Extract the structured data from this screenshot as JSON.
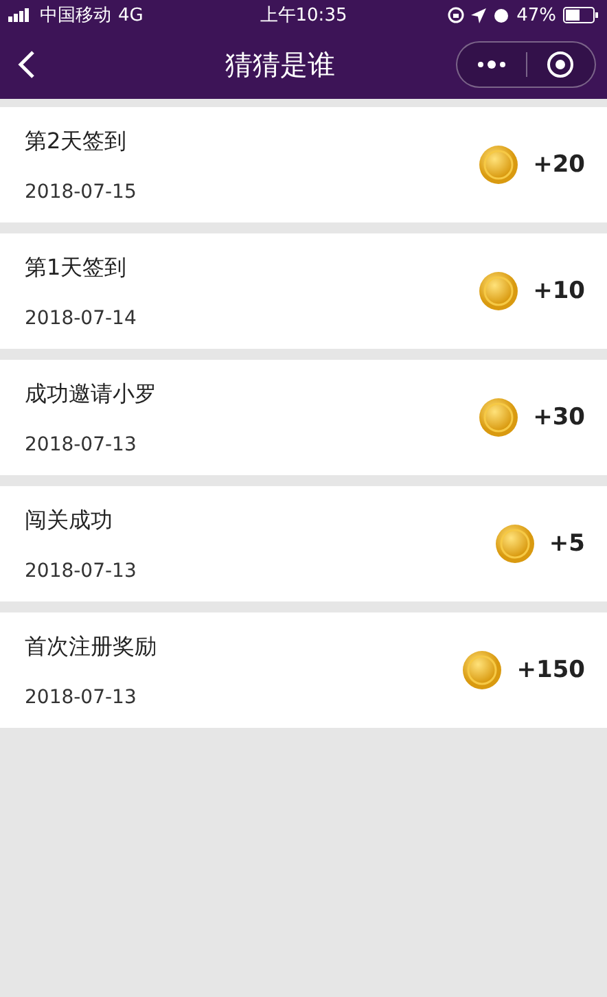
{
  "status_bar": {
    "carrier": "中国移动",
    "network": "4G",
    "time": "上午10:35",
    "battery": "47%"
  },
  "nav": {
    "title": "猜猜是谁"
  },
  "records": [
    {
      "title": "第2天签到",
      "date": "2018-07-15",
      "points": "+20"
    },
    {
      "title": "第1天签到",
      "date": "2018-07-14",
      "points": "+10"
    },
    {
      "title": "成功邀请小罗",
      "date": "2018-07-13",
      "points": "+30"
    },
    {
      "title": "闯关成功",
      "date": "2018-07-13",
      "points": "+5"
    },
    {
      "title": "首次注册奖励",
      "date": "2018-07-13",
      "points": "+150"
    }
  ]
}
